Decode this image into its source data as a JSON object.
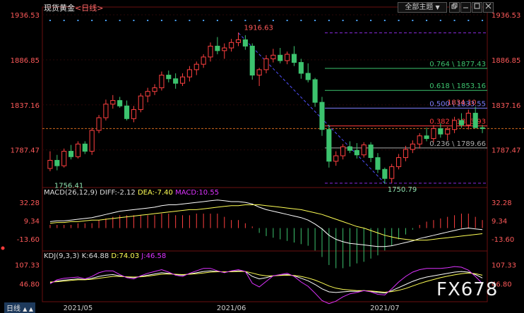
{
  "header": {
    "title": "现货黄金",
    "period": "<日线>",
    "theme_button": "全部主题",
    "dropdown_icon": "▼",
    "window_icons": [
      "restore-window-icon",
      "minimize-window-icon",
      "maximize-window-icon",
      "close-window-icon"
    ]
  },
  "price_axis": {
    "labels": [
      "1936.53",
      "1886.85",
      "1837.16",
      "1787.47"
    ]
  },
  "macd_header": {
    "name": "MACD(26,12,9)",
    "diff": "DIFF:-2.12",
    "dea": "DEA:-7.40",
    "macd": "MACD:10.55"
  },
  "macd_axis": {
    "labels": [
      "32.28",
      "9.34",
      "-13.60"
    ]
  },
  "kdj_header": {
    "name": "KDJ(9,3,3)",
    "k": "K:64.88",
    "d": "D:74.03",
    "j": "J:46.58"
  },
  "kdj_axis": {
    "labels": [
      "107.33",
      "46.80"
    ]
  },
  "x_axis": {
    "labels": [
      "2021/05",
      "2021/06",
      "2021/07"
    ]
  },
  "bottom_bar": {
    "label": "日线",
    "arrows": "▲ ▲"
  },
  "watermark": "FX678",
  "colors": {
    "up": "#ff4040",
    "down": "#3cc36e",
    "background": "#000000",
    "diff_line": "#ffffff",
    "dea_line": "#ffff55",
    "j_line": "#dd33ff",
    "fib_line": "#8a8a8a",
    "accent": "#ff3b3b"
  },
  "chart_data": [
    {
      "type": "candlestick",
      "title": "现货黄金<日线>",
      "y_axis_range": [
        1746,
        1942
      ],
      "y_tick_labels": [
        "1936.53",
        "1886.85",
        "1837.16",
        "1787.47"
      ],
      "x_tick_labels": [
        "2021/05",
        "2021/06",
        "2021/07"
      ],
      "current_price": 1811,
      "candles": [
        [
          1767,
          1786,
          1764,
          1776
        ],
        [
          1776,
          1782,
          1765,
          1770
        ],
        [
          1770,
          1789,
          1768,
          1786
        ],
        [
          1786,
          1793,
          1777,
          1780
        ],
        [
          1780,
          1797,
          1778,
          1794
        ],
        [
          1794,
          1797,
          1783,
          1786
        ],
        [
          1786,
          1812,
          1782,
          1809
        ],
        [
          1809,
          1826,
          1806,
          1823
        ],
        [
          1823,
          1843,
          1820,
          1838
        ],
        [
          1838,
          1848,
          1833,
          1842
        ],
        [
          1842,
          1846,
          1834,
          1836
        ],
        [
          1836,
          1842,
          1820,
          1822
        ],
        [
          1822,
          1836,
          1818,
          1832
        ],
        [
          1832,
          1850,
          1829,
          1847
        ],
        [
          1847,
          1856,
          1840,
          1852
        ],
        [
          1852,
          1860,
          1848,
          1856
        ],
        [
          1856,
          1874,
          1853,
          1870
        ],
        [
          1870,
          1875,
          1862,
          1866
        ],
        [
          1866,
          1872,
          1855,
          1861
        ],
        [
          1861,
          1872,
          1858,
          1868
        ],
        [
          1868,
          1880,
          1863,
          1876
        ],
        [
          1876,
          1885,
          1870,
          1882
        ],
        [
          1882,
          1893,
          1878,
          1890
        ],
        [
          1890,
          1906,
          1885,
          1902
        ],
        [
          1902,
          1912,
          1893,
          1897
        ],
        [
          1897,
          1905,
          1888,
          1900
        ],
        [
          1900,
          1910,
          1896,
          1906
        ],
        [
          1906,
          1917,
          1902,
          1909
        ],
        [
          1909,
          1914,
          1898,
          1902
        ],
        [
          1902,
          1905,
          1865,
          1870
        ],
        [
          1870,
          1878,
          1858,
          1876
        ],
        [
          1876,
          1892,
          1872,
          1888
        ],
        [
          1888,
          1899,
          1884,
          1892
        ],
        [
          1892,
          1900,
          1883,
          1886
        ],
        [
          1886,
          1896,
          1882,
          1893
        ],
        [
          1893,
          1902,
          1880,
          1884
        ],
        [
          1884,
          1888,
          1866,
          1872
        ],
        [
          1872,
          1883,
          1862,
          1865
        ],
        [
          1865,
          1867,
          1835,
          1840
        ],
        [
          1840,
          1846,
          1803,
          1810
        ],
        [
          1810,
          1815,
          1768,
          1775
        ],
        [
          1775,
          1786,
          1770,
          1781
        ],
        [
          1781,
          1794,
          1777,
          1791
        ],
        [
          1791,
          1797,
          1784,
          1787
        ],
        [
          1787,
          1795,
          1778,
          1782
        ],
        [
          1782,
          1796,
          1779,
          1793
        ],
        [
          1793,
          1796,
          1774,
          1779
        ],
        [
          1779,
          1784,
          1762,
          1766
        ],
        [
          1766,
          1768,
          1750,
          1756
        ],
        [
          1756,
          1772,
          1751,
          1769
        ],
        [
          1769,
          1783,
          1766,
          1779
        ],
        [
          1779,
          1792,
          1775,
          1788
        ],
        [
          1788,
          1798,
          1784,
          1794
        ],
        [
          1794,
          1806,
          1789,
          1803
        ],
        [
          1803,
          1812,
          1797,
          1800
        ],
        [
          1800,
          1815,
          1796,
          1811
        ],
        [
          1811,
          1817,
          1801,
          1805
        ],
        [
          1805,
          1813,
          1798,
          1810
        ],
        [
          1810,
          1824,
          1806,
          1820
        ],
        [
          1820,
          1828,
          1812,
          1815
        ],
        [
          1815,
          1832,
          1810,
          1828
        ],
        [
          1828,
          1835,
          1818,
          1812
        ],
        [
          1812,
          1815,
          1806,
          1811
        ]
      ],
      "annotations": [
        {
          "text": "1916.63",
          "kind": "high"
        },
        {
          "text": "1756.41",
          "kind": "low"
        },
        {
          "text": "1750.79",
          "kind": "low"
        },
        {
          "text": "1834.10",
          "kind": "high"
        }
      ],
      "fibonacci": [
        {
          "label": "0.764 \\ 1877.43",
          "price": 1877.43,
          "color": "#3cc36e"
        },
        {
          "label": "0.618 \\ 1853.16",
          "price": 1853.16,
          "color": "#3cc36e"
        },
        {
          "label": "0.500 \\ 1833.55",
          "price": 1833.55,
          "color": "#7f7fff"
        },
        {
          "label": "0.382 \\ 1813.93",
          "price": 1813.93,
          "color": "#ff3b3b"
        },
        {
          "label": "0.236 \\ 1789.66",
          "price": 1789.66,
          "color": "#aaaaaa"
        }
      ]
    },
    {
      "type": "line+bar",
      "title": "MACD(26,12,9)",
      "y_axis_range": [
        -25,
        40
      ],
      "y_tick_labels": [
        "32.28",
        "9.34",
        "-13.60"
      ],
      "series": [
        {
          "name": "DIFF",
          "values": [
            8,
            9,
            9,
            10,
            11,
            12,
            13,
            15,
            17,
            19,
            21,
            22,
            23,
            24,
            25,
            26,
            28,
            29,
            29,
            30,
            31,
            32,
            33,
            34,
            35,
            34,
            33,
            33,
            32,
            30,
            26,
            23,
            21,
            19,
            17,
            15,
            13,
            10,
            5,
            -1,
            -9,
            -14,
            -17,
            -19,
            -20,
            -21,
            -22,
            -23,
            -23,
            -22,
            -20,
            -18,
            -16,
            -13,
            -11,
            -9,
            -7,
            -5,
            -3,
            -1,
            0,
            -1,
            -2
          ]
        },
        {
          "name": "DEA",
          "values": [
            6,
            7,
            7,
            8,
            8,
            9,
            10,
            10,
            11,
            12,
            13,
            14,
            15,
            16,
            17,
            18,
            19,
            20,
            21,
            22,
            23,
            23,
            24,
            25,
            26,
            27,
            28,
            28,
            29,
            29,
            29,
            28,
            27,
            26,
            25,
            24,
            23,
            21,
            19,
            17,
            14,
            11,
            8,
            5,
            2,
            0,
            -3,
            -6,
            -9,
            -11,
            -13,
            -14,
            -15,
            -15,
            -15,
            -14,
            -13,
            -12,
            -11,
            -10,
            -9,
            -8,
            -7
          ]
        },
        {
          "name": "MACD",
          "values": [
            4,
            4,
            4,
            4,
            6,
            6,
            6,
            10,
            12,
            14,
            16,
            16,
            16,
            16,
            16,
            16,
            18,
            18,
            16,
            16,
            16,
            18,
            18,
            18,
            18,
            14,
            10,
            10,
            6,
            2,
            -6,
            -10,
            -12,
            -14,
            -16,
            -18,
            -20,
            -22,
            -28,
            -36,
            -46,
            -50,
            -50,
            -48,
            -44,
            -42,
            -38,
            -34,
            -28,
            -22,
            -14,
            -8,
            -2,
            4,
            8,
            10,
            12,
            14,
            16,
            18,
            18,
            14,
            10
          ]
        }
      ]
    },
    {
      "type": "line",
      "title": "KDJ(9,3,3)",
      "y_axis_range": [
        -5,
        125
      ],
      "y_tick_labels": [
        "107.33",
        "46.80"
      ],
      "series": [
        {
          "name": "K",
          "values": [
            50,
            55,
            58,
            60,
            62,
            60,
            64,
            70,
            74,
            76,
            72,
            68,
            66,
            70,
            74,
            78,
            82,
            80,
            76,
            74,
            78,
            82,
            86,
            88,
            86,
            84,
            86,
            88,
            86,
            70,
            62,
            66,
            72,
            74,
            76,
            72,
            64,
            56,
            44,
            30,
            20,
            18,
            20,
            22,
            22,
            24,
            22,
            18,
            16,
            24,
            34,
            44,
            54,
            62,
            68,
            72,
            76,
            80,
            84,
            86,
            84,
            76,
            65
          ]
        },
        {
          "name": "D",
          "values": [
            52,
            53,
            55,
            57,
            59,
            59,
            61,
            64,
            67,
            70,
            70,
            69,
            68,
            69,
            71,
            74,
            77,
            78,
            77,
            76,
            77,
            79,
            81,
            84,
            85,
            85,
            85,
            86,
            86,
            81,
            75,
            72,
            72,
            73,
            74,
            73,
            70,
            65,
            58,
            49,
            39,
            32,
            28,
            26,
            24,
            24,
            23,
            21,
            19,
            21,
            25,
            31,
            39,
            47,
            54,
            60,
            66,
            71,
            75,
            79,
            81,
            79,
            74
          ]
        },
        {
          "name": "J",
          "values": [
            46,
            59,
            64,
            66,
            68,
            62,
            70,
            82,
            88,
            88,
            76,
            66,
            62,
            72,
            80,
            86,
            92,
            84,
            74,
            70,
            80,
            88,
            96,
            96,
            88,
            82,
            88,
            92,
            86,
            48,
            36,
            54,
            72,
            76,
            80,
            70,
            52,
            38,
            16,
            -8,
            -18,
            -10,
            4,
            14,
            18,
            24,
            20,
            12,
            10,
            30,
            52,
            70,
            84,
            92,
            96,
            96,
            96,
            98,
            102,
            100,
            90,
            70,
            47
          ]
        }
      ]
    }
  ]
}
